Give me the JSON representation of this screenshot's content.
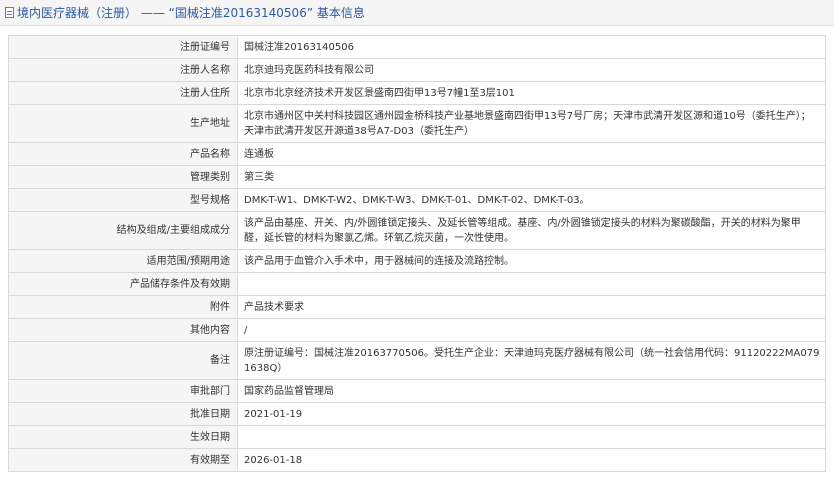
{
  "header": {
    "title": "境内医疗器械（注册） —— “国械注准20163140506” 基本信息"
  },
  "rows": [
    {
      "label": "注册证编号",
      "value": "国械注准20163140506"
    },
    {
      "label": "注册人名称",
      "value": "北京迪玛克医药科技有限公司"
    },
    {
      "label": "注册人住所",
      "value": "北京市北京经济技术开发区景盛南四街甲13号7幢1至3层101"
    },
    {
      "label": "生产地址",
      "value": "北京市通州区中关村科技园区通州园金桥科技产业基地景盛南四街甲13号7号厂房；天津市武清开发区源和道10号（委托生产）；天津市武清开发区开源道38号A7-D03（委托生产）"
    },
    {
      "label": "产品名称",
      "value": "连通板"
    },
    {
      "label": "管理类别",
      "value": "第三类"
    },
    {
      "label": "型号规格",
      "value": "DMK-T-W1、DMK-T-W2、DMK-T-W3、DMK-T-01、DMK-T-02、DMK-T-03。"
    },
    {
      "label": "结构及组成/主要组成成分",
      "value": "该产品由基座、开关、内/外圆锥锁定接头、及延长管等组成。基座、内/外圆锥锁定接头的材料为聚碳酸酯，开关的材料为聚甲醛，延长管的材料为聚氯乙烯。环氧乙烷灭菌，一次性使用。"
    },
    {
      "label": "适用范围/预期用途",
      "value": "该产品用于血管介入手术中，用于器械间的连接及流路控制。"
    },
    {
      "label": "产品储存条件及有效期",
      "value": ""
    },
    {
      "label": "附件",
      "value": "产品技术要求"
    },
    {
      "label": "其他内容",
      "value": "/"
    },
    {
      "label": "备注",
      "value": "原注册证编号：国械注准20163770506。受托生产企业：天津迪玛克医疗器械有限公司（统一社会信用代码：91120222MA0791638Q）"
    },
    {
      "label": "审批部门",
      "value": "国家药品监督管理局"
    },
    {
      "label": "批准日期",
      "value": "2021-01-19"
    },
    {
      "label": "生效日期",
      "value": ""
    },
    {
      "label": "有效期至",
      "value": "2026-01-18"
    }
  ]
}
